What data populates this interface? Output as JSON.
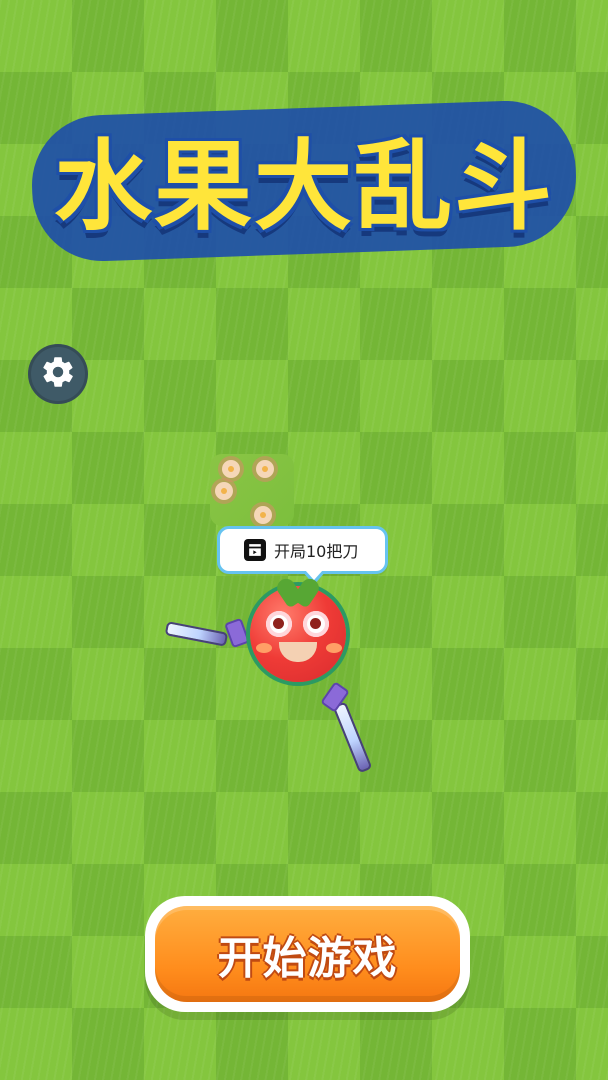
{
  "game": {
    "title": "水果大乱斗",
    "tooltip_label": "开局10把刀",
    "start_button_label": "开始游戏"
  },
  "icons": {
    "settings": "gear-icon",
    "video": "video-play-icon"
  },
  "colors": {
    "grass_light": "#84c63e",
    "grass_dark": "#74b636",
    "title_fill": "#ffe53a",
    "title_stroke": "#1e4fa8",
    "tooltip_border": "#66c3f0",
    "start_button": "#ff8d1d",
    "fruit_red": "#ef3b36",
    "settings_bg": "#3f5a67"
  }
}
